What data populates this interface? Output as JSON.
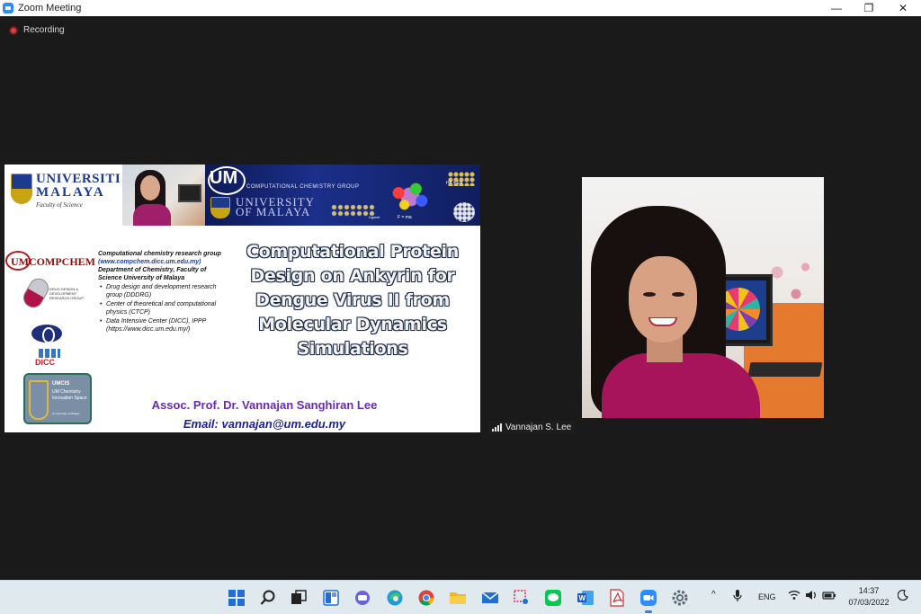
{
  "window": {
    "title": "Zoom Meeting",
    "minimize_glyph": "—",
    "restore_glyph": "❐",
    "close_glyph": "✕"
  },
  "meeting": {
    "recording_label": "Recording",
    "participant_name": "Vannajan S. Lee"
  },
  "slide": {
    "um_name_line1": "UNIVERSITI",
    "um_name_line2": "MALAYA",
    "um_faculty": "Faculty of Science",
    "banner_um": "UM",
    "banner_group": "COMPUTATIONAL CHEMISTRY GROUP",
    "banner_university_line1": "UNIVERSITY",
    "banner_university_line2": "OF MALAYA",
    "banner_eq1": "H¥ = E¥",
    "banner_eq2": "F = ma",
    "banner_eq3": "Ligand",
    "compchem_logo": "UMCOMPCHEM",
    "ddrg_text": "DRUG DESIGN & DEVELOPMENT RESEARCH GROUP",
    "dicc_logo": "DICC",
    "umcis_title": "UMCIS",
    "umcis_subtitle": "UM Chemistry Innovation Space",
    "umcis_small": "at University of Malaya",
    "info_group": "Computational chemistry research group",
    "info_url": "(www.compchem.dicc.um.edu.my)",
    "info_dept": "Department of Chemistry, Faculty of Science University of Malaya",
    "bullets": [
      "Drug design and development research group (DDDRG)",
      "Center of theoretical and computational physics (CTCP)",
      "Data Intensive Center (DICC), IPPP (https://www.dicc.um.edu.my/)"
    ],
    "title": "Computational Protein Design on Ankyrin for Dengue Virus II from Molecular Dynamics Simulations",
    "presenter": "Assoc. Prof. Dr. Vannajan Sanghiran Lee",
    "email": "Email: vannajan@um.edu.my"
  },
  "taskbar": {
    "icons": [
      "windows-start-icon",
      "search-icon",
      "task-view-icon",
      "widgets-icon",
      "teams-chat-icon",
      "edge-browser-icon",
      "chrome-browser-icon",
      "file-explorer-icon",
      "mail-icon",
      "snipping-tool-icon",
      "line-app-icon",
      "word-icon",
      "acrobat-icon",
      "zoom-icon",
      "settings-icon"
    ],
    "tray_chevron": "^",
    "language": "ENG",
    "time": "14:37",
    "date": "07/03/2022"
  },
  "colors": {
    "meeting_background": "#1a1a1a",
    "taskbar_background": "#dfe9ee",
    "recording_red": "#e23c3c",
    "slide_title_outline": "#1c2a44",
    "presenter_purple": "#6b2bb0",
    "email_blue": "#1c1f9a"
  }
}
